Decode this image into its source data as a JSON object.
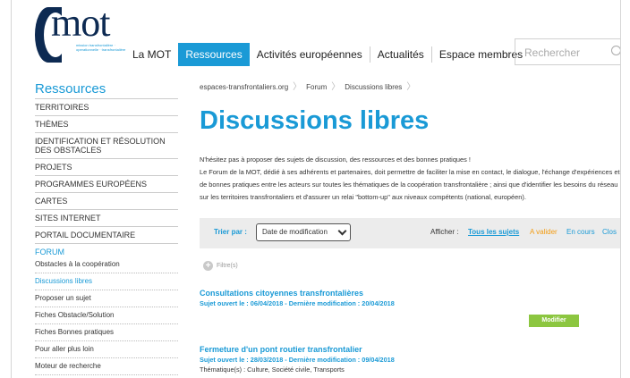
{
  "brand": {
    "name": "mot",
    "tagline": "mission transfrontalière · operationnelle · transfrontalière",
    "color": "#0d2a52"
  },
  "accent_color": "#1a9ad6",
  "nav": {
    "items": [
      {
        "label": "La MOT",
        "active": false
      },
      {
        "label": "Ressources",
        "active": true
      },
      {
        "label": "Activités européennes",
        "active": false
      },
      {
        "label": "Actualités",
        "active": false
      },
      {
        "label": "Espace membres",
        "active": false
      }
    ]
  },
  "search": {
    "placeholder": "Rechercher"
  },
  "sidebar": {
    "title": "Ressources",
    "items": [
      "TERRITOIRES",
      "THÈMES",
      "IDENTIFICATION ET RÉSOLUTION DES OBSTACLES",
      "PROJETS",
      "PROGRAMMES EUROPÉENS",
      "CARTES",
      "SITES INTERNET",
      "PORTAIL DOCUMENTAIRE"
    ],
    "forum_label": "FORUM",
    "forum_items": [
      {
        "label": "Obstacles à la coopération",
        "active": false
      },
      {
        "label": "Discussions libres",
        "active": true
      },
      {
        "label": "Proposer un sujet",
        "active": false
      },
      {
        "label": "Fiches Obstacle/Solution",
        "active": false
      },
      {
        "label": "Fiches Bonnes pratiques",
        "active": false
      },
      {
        "label": "Pour aller plus loin",
        "active": false
      },
      {
        "label": "Moteur de recherche",
        "active": false
      }
    ]
  },
  "breadcrumb": [
    "espaces-transfrontaliers.org",
    "Forum",
    "Discussions libres"
  ],
  "page_title": "Discussions libres",
  "intro": {
    "line1": "N'hésitez pas à proposer des sujets de discussion, des ressources et des bonnes pratiques !",
    "line2": "Le Forum de la MOT, dédié à ses adhérents et partenaires, doit permettre de faciliter la mise en contact, le dialogue, l'échange d'expériences et de bonnes pratiques entre les acteurs sur toutes les thématiques de la coopération transfrontalière ; ainsi que d'identifier les besoins du réseau sur les territoires transfrontaliers et d'assurer un relai \"bottom-up\" aux niveaux compétents (national, européen)."
  },
  "filters": {
    "sort_label": "Trier par :",
    "sort_value": "Date de modification",
    "show_label": "Afficher :",
    "show_options": [
      {
        "label": "Tous les sujets",
        "active": true,
        "color": "#1a9ad6"
      },
      {
        "label": "A valider",
        "active": false,
        "color": "#f39c12"
      },
      {
        "label": "En cours",
        "active": false,
        "color": "#1a9ad6"
      },
      {
        "label": "Clos",
        "active": false,
        "color": "#1a9ad6"
      }
    ],
    "toggle_label": "Filtre(s)"
  },
  "topics": [
    {
      "title": "Consultations citoyennes transfrontalières",
      "meta": "Sujet ouvert le : 06/04/2018 - Dernière modification : 20/04/2018",
      "button": "Modifier"
    },
    {
      "title": "Fermeture d'un pont routier transfrontalier",
      "meta": "Sujet ouvert le : 28/03/2018 - Dernière modification : 09/04/2018",
      "theme_label": "Thématique(s) :",
      "themes": "Culture, Société civile, Transports"
    }
  ]
}
